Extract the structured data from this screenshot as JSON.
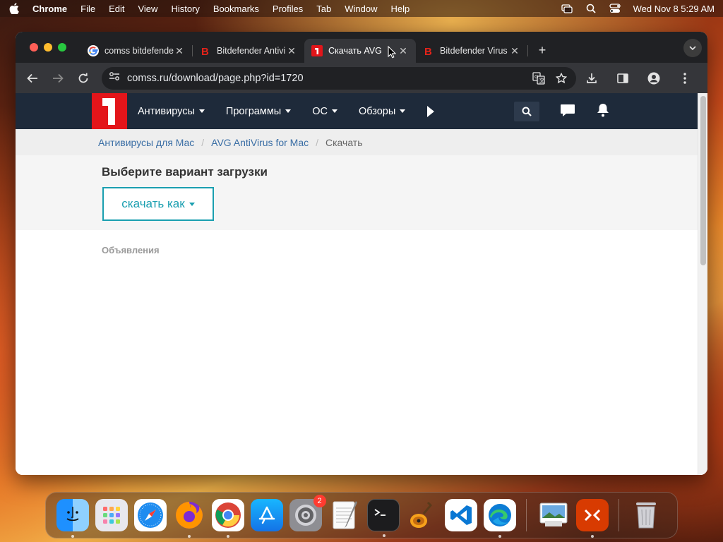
{
  "menubar": {
    "app_name": "Chrome",
    "items": [
      "File",
      "Edit",
      "View",
      "History",
      "Bookmarks",
      "Profiles",
      "Tab",
      "Window",
      "Help"
    ],
    "datetime": "Wed Nov 8  5:29 AM"
  },
  "browser": {
    "tabs": [
      {
        "title": "comss bitdefender",
        "favicon": "google-icon",
        "active": false
      },
      {
        "title": "Bitdefender Antivirus",
        "favicon": "bitdefender-icon",
        "active": false
      },
      {
        "title": "Скачать AVG",
        "favicon": "comss-icon",
        "active": true
      },
      {
        "title": "Bitdefender Virus",
        "favicon": "bitdefender-icon",
        "active": false
      }
    ],
    "url": "comss.ru/download/page.php?id=1720"
  },
  "site": {
    "nav": {
      "items": [
        "Антивирусы",
        "Программы",
        "ОС",
        "Обзоры"
      ]
    },
    "breadcrumb": {
      "items": [
        "Антивирусы для Mac",
        "AVG AntiVirus for Mac"
      ],
      "current": "Скачать"
    },
    "download": {
      "heading": "Выберите вариант загрузки",
      "button_label": "скачать как"
    },
    "ads_label": "Объявления"
  },
  "dock": {
    "apps": [
      "Finder",
      "Launchpad",
      "Safari",
      "Firefox",
      "Chrome",
      "App Store",
      "System Settings",
      "TextEdit",
      "Terminal",
      "GarageBand",
      "Visual Studio Code",
      "Microsoft Edge",
      "Preview",
      "Remote Desktop",
      "Trash"
    ],
    "settings_badge": "2"
  },
  "colors": {
    "site_nav_bg": "#1e2a3a",
    "logo_red": "#e3151a",
    "accent_teal": "#1a9fb0",
    "link_blue": "#3a6ea5"
  }
}
